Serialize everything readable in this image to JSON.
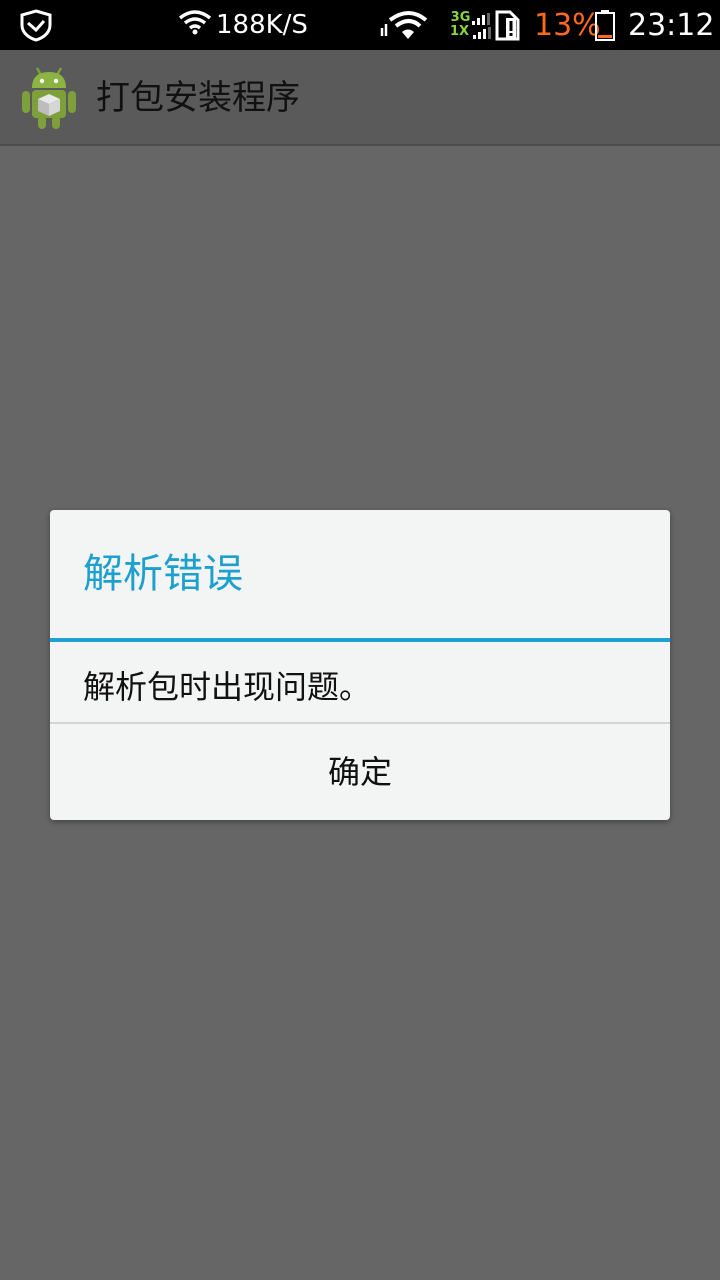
{
  "status_bar": {
    "net_speed": "188K/S",
    "network_3g": "3G",
    "network_1x": "1X",
    "battery_percent": "13%",
    "time": "23:12",
    "icons": [
      "shield-icon",
      "wifi-icon",
      "data-activity-icon",
      "signal-icon",
      "sim-alert-icon",
      "battery-icon"
    ]
  },
  "action_bar": {
    "title": "打包安装程序",
    "icon": "android-package-icon"
  },
  "dialog": {
    "title": "解析错误",
    "message": "解析包时出现问题。",
    "ok_label": "确定"
  },
  "colors": {
    "accent": "#1ea0cf",
    "battery_low": "#ff6a1a",
    "network": "#8bd43a",
    "background": "#666666"
  }
}
